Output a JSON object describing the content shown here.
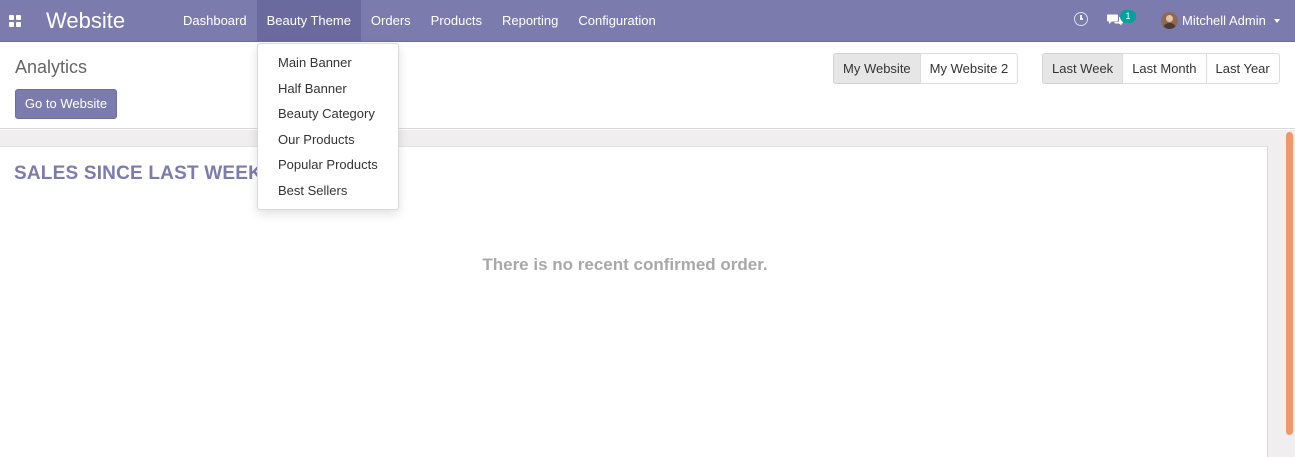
{
  "navbar": {
    "brand": "Website",
    "menu": [
      {
        "label": "Dashboard"
      },
      {
        "label": "Beauty Theme"
      },
      {
        "label": "Orders"
      },
      {
        "label": "Products"
      },
      {
        "label": "Reporting"
      },
      {
        "label": "Configuration"
      }
    ],
    "active_menu": "Beauty Theme",
    "chat_badge": "1",
    "user_name": "Mitchell Admin",
    "icons": {
      "apps": "apps-grid-icon",
      "activity": "clock-icon",
      "messages": "chat-icon",
      "user": "avatar"
    },
    "color": "#7c7bad"
  },
  "dropdown": {
    "items": [
      {
        "label": "Main Banner"
      },
      {
        "label": "Half Banner"
      },
      {
        "label": "Beauty Category"
      },
      {
        "label": "Our Products"
      },
      {
        "label": "Popular Products"
      },
      {
        "label": "Best Sellers"
      }
    ]
  },
  "control_panel": {
    "title": "Analytics",
    "go_to_website": "Go to Website",
    "websites": [
      {
        "label": "My Website",
        "selected": true
      },
      {
        "label": "My Website 2",
        "selected": false
      }
    ],
    "periods": [
      {
        "label": "Last Week",
        "selected": true
      },
      {
        "label": "Last Month",
        "selected": false
      },
      {
        "label": "Last Year",
        "selected": false
      }
    ]
  },
  "dashboard": {
    "sales_title": "SALES SINCE LAST WEEK",
    "empty_message": "There is no recent confirmed order."
  }
}
